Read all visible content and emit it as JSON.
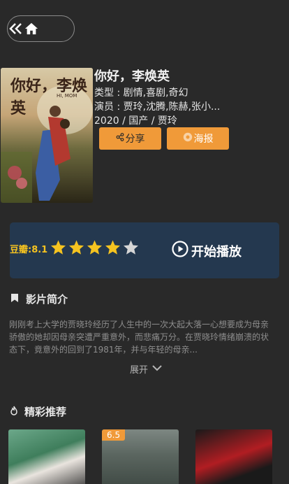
{
  "nav": {
    "back_icon": "double-chevron-left-icon",
    "home_icon": "home-icon"
  },
  "movie": {
    "title": "你好，李焕英",
    "type_line": "类型 : 剧情,喜剧,奇幻",
    "cast_line": "演员 : 贾玲,沈腾,陈赫,张小...",
    "year_line": "2020 / 国产 / 贾玲",
    "poster_text": "你好，李焕英",
    "poster_subtitle": "HI, MOM"
  },
  "actions": {
    "share_label": "分享",
    "poster_label": "海报"
  },
  "rating": {
    "label": "豆瓣:8.1",
    "value": 8.1,
    "stars_full": 4,
    "stars_total": 5
  },
  "play": {
    "label": "开始播放"
  },
  "synopsis": {
    "heading": "影片简介",
    "text": "刚刚考上大学的贾晓玲经历了人生中的一次大起大落一心想要成为母亲骄傲的她却因母亲突遭严重意外，而悲痛万分。在贾晓玲情绪崩溃的状态下，竟意外的回到了1981年，并与年轻的母亲...",
    "expand_label": "展开"
  },
  "recommend": {
    "heading": "精彩推荐",
    "items": [
      {
        "badge": ""
      },
      {
        "badge": "6.5"
      },
      {
        "badge": ""
      }
    ]
  },
  "colors": {
    "accent": "#f09a39",
    "card": "#24384f",
    "star": "#f5c320",
    "background": "#292929"
  }
}
